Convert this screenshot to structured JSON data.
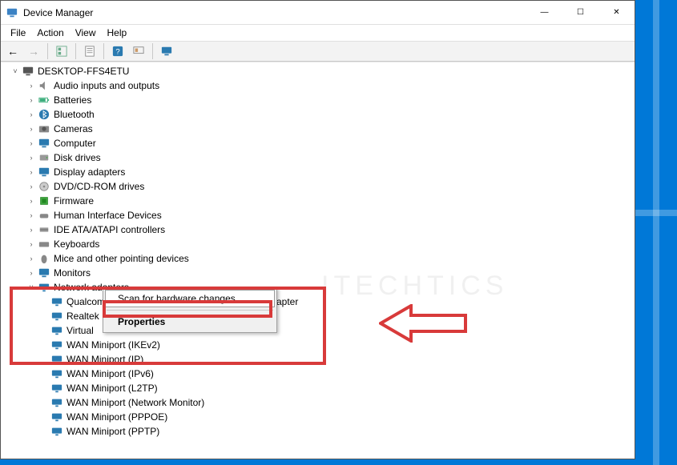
{
  "window": {
    "title": "Device Manager",
    "controls": {
      "min": "—",
      "max": "☐",
      "close": "✕"
    }
  },
  "menubar": {
    "items": [
      "File",
      "Action",
      "View",
      "Help"
    ]
  },
  "toolbar": {
    "back": "←",
    "forward": "→",
    "icons": [
      "show-hide-console-tree",
      "properties",
      "help",
      "scan-hardware",
      "monitor"
    ]
  },
  "root": {
    "name": "DESKTOP-FFS4ETU",
    "expanded": true
  },
  "categories": [
    {
      "label": "Audio inputs and outputs",
      "icon": "speaker"
    },
    {
      "label": "Batteries",
      "icon": "battery"
    },
    {
      "label": "Bluetooth",
      "icon": "bluetooth"
    },
    {
      "label": "Cameras",
      "icon": "camera"
    },
    {
      "label": "Computer",
      "icon": "computer"
    },
    {
      "label": "Disk drives",
      "icon": "disk"
    },
    {
      "label": "Display adapters",
      "icon": "display"
    },
    {
      "label": "DVD/CD-ROM drives",
      "icon": "dvd"
    },
    {
      "label": "Firmware",
      "icon": "firmware"
    },
    {
      "label": "Human Interface Devices",
      "icon": "hid"
    },
    {
      "label": "IDE ATA/ATAPI controllers",
      "icon": "ide"
    },
    {
      "label": "Keyboards",
      "icon": "keyboard"
    },
    {
      "label": "Mice and other pointing devices",
      "icon": "mouse"
    },
    {
      "label": "Monitors",
      "icon": "monitor"
    }
  ],
  "network": {
    "label": "Network adapters",
    "expanded": true,
    "devices_partial": [
      {
        "label": "Qualcomm",
        "suffix_visible": "apter"
      },
      {
        "label": "Realtek"
      },
      {
        "label": "Virtual"
      }
    ],
    "devices_full": [
      "WAN Miniport (IKEv2)",
      "WAN Miniport (IP)",
      "WAN Miniport (IPv6)",
      "WAN Miniport (L2TP)",
      "WAN Miniport (Network Monitor)",
      "WAN Miniport (PPPOE)",
      "WAN Miniport (PPTP)"
    ]
  },
  "context_menu": {
    "scan": "Scan for hardware changes",
    "properties": "Properties"
  },
  "watermark": "ITECHTICS"
}
